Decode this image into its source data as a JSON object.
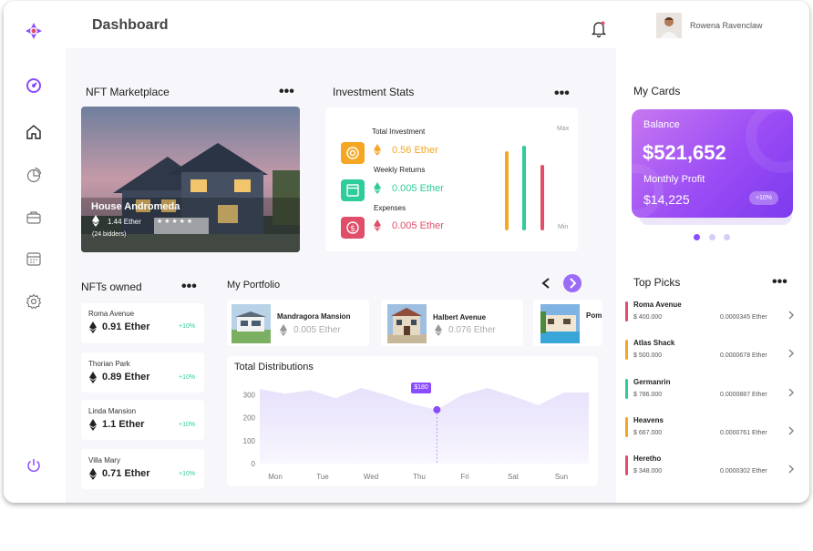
{
  "header": {
    "title": "Dashboard",
    "user_name": "Rowena Ravenclaw"
  },
  "nft_marketplace": {
    "title": "NFT Marketplace",
    "name": "House Andromeda",
    "price": "1.44 Ether",
    "stars": "★ ★ ★ ★ ★",
    "bidders": "(24 bidders)"
  },
  "investment_stats": {
    "title": "Investment Stats",
    "items": [
      {
        "label": "Total Investment",
        "value": "0.56 Ether",
        "color": "#f5a623"
      },
      {
        "label": "Weekly Returns",
        "value": "0.005 Ether",
        "color": "#2ecc9a"
      },
      {
        "label": "Expenses",
        "value": "0.005 Ether",
        "color": "#e04e6a"
      }
    ],
    "max_label": "Max",
    "min_label": "Min",
    "bars": [
      {
        "color": "#f5a623",
        "level": 0.78
      },
      {
        "color": "#2ecc9a",
        "level": 0.83
      },
      {
        "color": "#e04e6a",
        "level": 0.64
      }
    ]
  },
  "nfts_owned": {
    "title": "NFTs owned",
    "items": [
      {
        "name": "Roma Avenue",
        "value": "0.91 Ether",
        "change": "+10%"
      },
      {
        "name": "Thorian Park",
        "value": "0.89 Ether",
        "change": "+10%"
      },
      {
        "name": "Linda Mansion",
        "value": "1.1 Ether",
        "change": "+10%"
      },
      {
        "name": "Villa Mary",
        "value": "0.71 Ether",
        "change": "+10%"
      }
    ]
  },
  "portfolio": {
    "title": "My Portfolio",
    "items": [
      {
        "name": "Mandragora Mansion",
        "value": "0.005 Ether"
      },
      {
        "name": "Halbert Avenue",
        "value": "0.076 Ether"
      },
      {
        "name": "Pom",
        "value": ""
      }
    ]
  },
  "distributions": {
    "title": "Total Distributions",
    "tooltip": "$180"
  },
  "chart_data": {
    "type": "area",
    "title": "Total Distributions",
    "categories": [
      "Mon",
      "Tue",
      "Wed",
      "Thu",
      "Fri",
      "Sat",
      "Sun"
    ],
    "yticks": [
      "300",
      "200",
      "100",
      "0"
    ],
    "ylim": [
      0,
      350
    ],
    "x": [
      "Mon",
      "",
      "Tue",
      "",
      "Wed",
      "",
      "Thu",
      "",
      "Fri",
      "",
      "Sat",
      "",
      "Sun",
      ""
    ],
    "values": [
      325,
      305,
      320,
      285,
      330,
      300,
      260,
      235,
      300,
      330,
      295,
      255,
      310,
      310
    ],
    "highlight_index": 7,
    "grid": false,
    "legend": "none"
  },
  "my_cards": {
    "title": "My Cards",
    "balance_label": "Balance",
    "balance": "$521,652",
    "profit_label": "Monthly Profit",
    "profit": "$14,225",
    "change": "+10%"
  },
  "top_picks": {
    "title": "Top Picks",
    "items": [
      {
        "name": "Roma Avenue",
        "price": "$ 400.000",
        "eth": "0.0000345 Ether",
        "color": "#e04e6a"
      },
      {
        "name": "Atlas Shack",
        "price": "$ 500.000",
        "eth": "0.0000678 Ether",
        "color": "#f5a623"
      },
      {
        "name": "Germanrin",
        "price": "$ 786.000",
        "eth": "0.0000887 Ether",
        "color": "#2ecc9a"
      },
      {
        "name": "Heavens",
        "price": "$ 667.000",
        "eth": "0.0000761 Ether",
        "color": "#f5a623"
      },
      {
        "name": "Heretho",
        "price": "$ 348.000",
        "eth": "0.0000302 Ether",
        "color": "#e04e6a"
      }
    ]
  },
  "colors": {
    "accent": "#8a4dfd",
    "gradient_start": "#c678f0",
    "gradient_end": "#7c3aed"
  }
}
